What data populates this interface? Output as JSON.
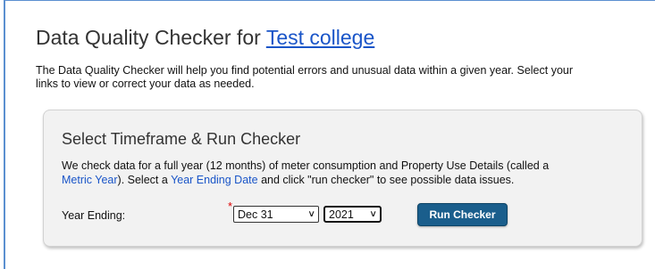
{
  "header": {
    "title_prefix": "Data Quality Checker for",
    "property_link": "Test college"
  },
  "intro": {
    "line1": "The Data Quality Checker will help you find potential errors and unusual data within a given year. Select your",
    "line2": "links to view or correct your data as needed."
  },
  "panel": {
    "title": "Select Timeframe & Run Checker",
    "desc_part1": "We check data for a full year (12 months) of meter consumption and Property Use Details (called a",
    "metric_year_link": "Metric Year",
    "desc_part2": "). Select a",
    "year_ending_date_link": "Year Ending Date",
    "desc_part3": "and click \"run checker\" to see possible data issues.",
    "year_ending_label": "Year Ending:",
    "required_marker": "*",
    "month_value": "Dec 31",
    "year_value": "2021",
    "run_button": "Run Checker"
  },
  "colors": {
    "link": "#1a55c8",
    "button_bg": "#1a5e8c",
    "panel_bg": "#f2f2f2",
    "frame_border": "#5b8fd0"
  }
}
